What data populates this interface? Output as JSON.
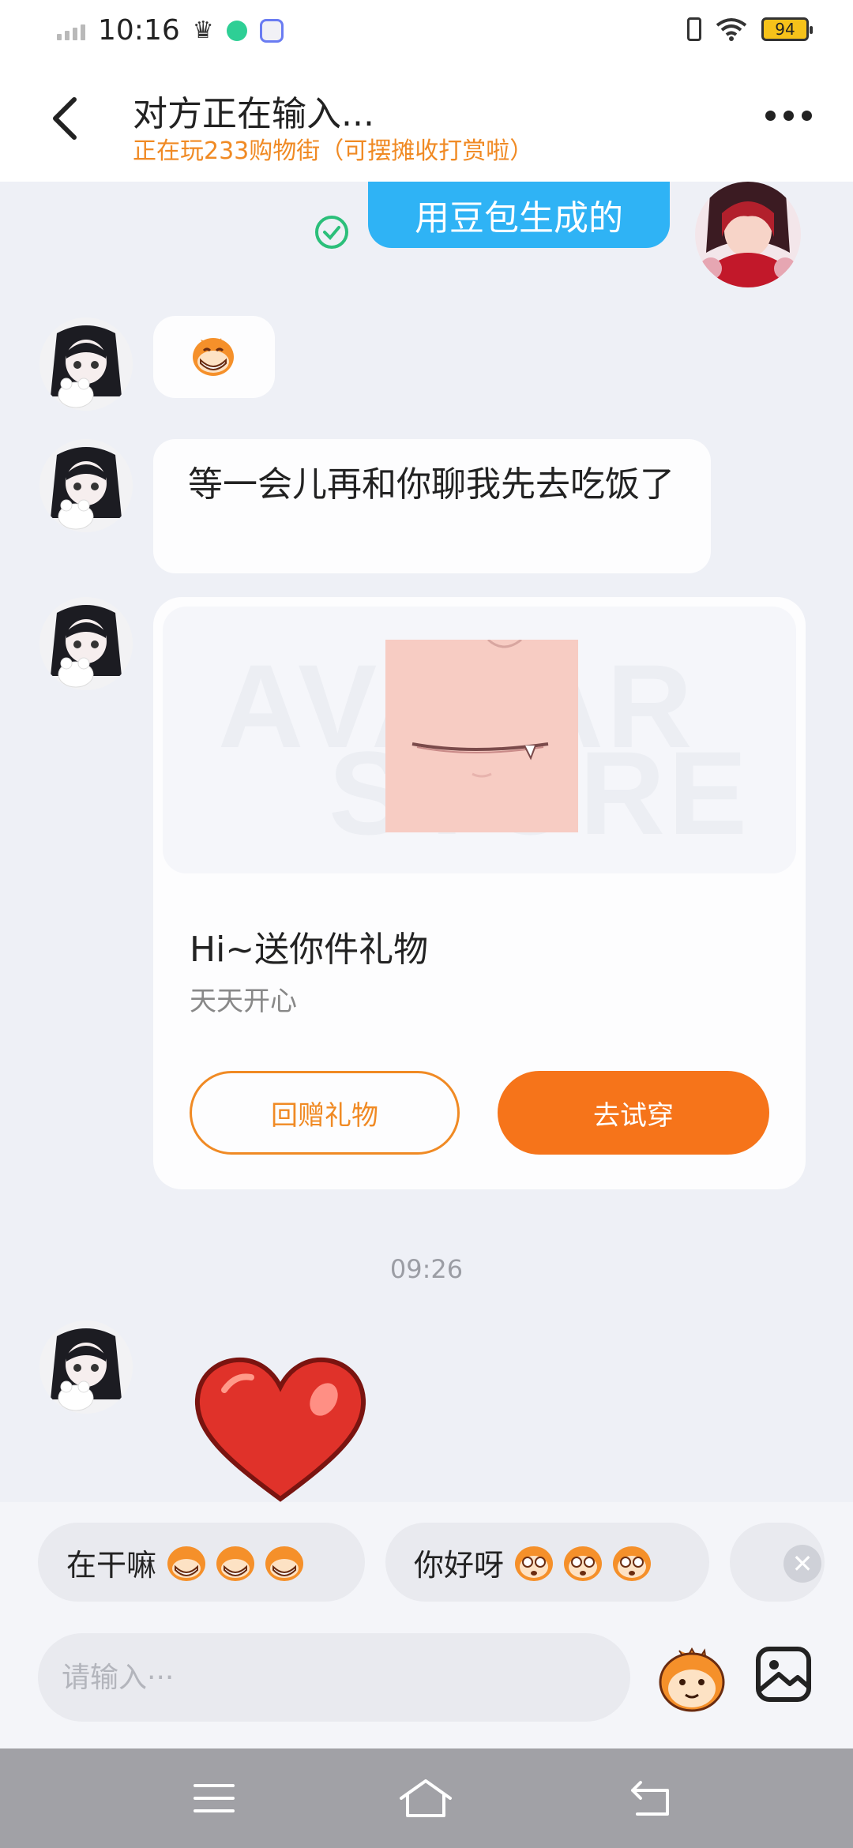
{
  "status_bar": {
    "time": "10:16",
    "battery": "94",
    "battery_color": "#f6c21a"
  },
  "header": {
    "title": "对方正在输入...",
    "subtitle": "正在玩233购物街（可摆摊收打赏啦）",
    "back_icon": "chevron-left-icon",
    "more_icon": "more-dots-icon"
  },
  "messages": {
    "sent_text": "用豆包生成的",
    "sent_status_icon": "check-circle-icon",
    "msg_emoji_icon": "grinning-monkey-emoji",
    "msg_text": "等一会儿再和你聊我先去吃饭了",
    "gift": {
      "watermark_line1": "AVATAR",
      "watermark_line2": "STORE",
      "title": "Hi~送你件礼物",
      "description": "天天开心",
      "return_gift_label": "回赠礼物",
      "try_on_label": "去试穿"
    },
    "timestamp": "09:26",
    "sticker_icon": "red-heart-sticker"
  },
  "quick_replies": {
    "items": [
      {
        "text": "在干嘛",
        "emoji": "grinning-monkey-emoji"
      },
      {
        "text": "你好呀",
        "emoji": "surprised-monkey-emoji"
      }
    ],
    "close_icon": "close-icon"
  },
  "input": {
    "placeholder": "请输入···",
    "emoji_button_icon": "monkey-face-icon",
    "image_button_icon": "image-icon"
  },
  "colors": {
    "accent_orange": "#f6741a",
    "subtitle_orange": "#f08a24",
    "sent_bubble_blue": "#2fb3f5",
    "chat_background": "#eef0f6"
  }
}
